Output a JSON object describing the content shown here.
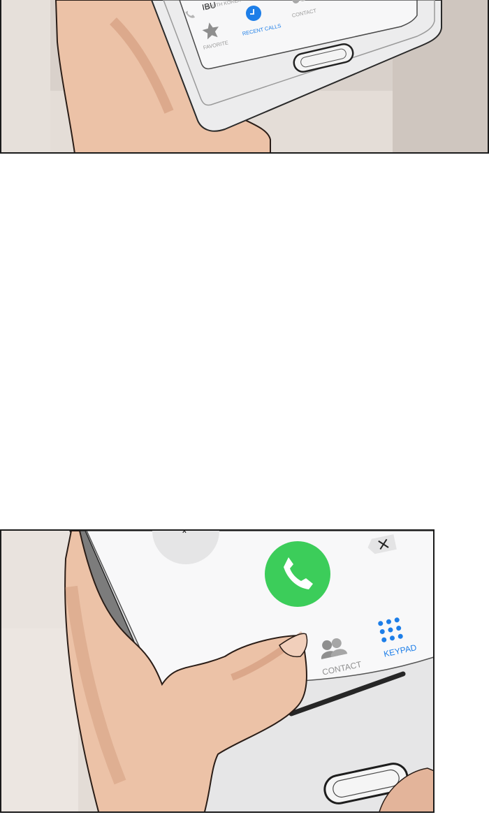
{
  "top_panel": {
    "phone": {
      "contact_name": "IBU",
      "contact_location": "SOUTH KOREA",
      "tabs": [
        {
          "label": "FAVORITE",
          "icon": "star-icon",
          "active": false
        },
        {
          "label": "RECENT CALLS",
          "icon": "clock-icon",
          "active": true
        },
        {
          "label": "CONTACT",
          "icon": "contacts-icon",
          "active": false
        }
      ]
    }
  },
  "bottom_panel": {
    "phone": {
      "call_button_icon": "phone-handset-icon",
      "delete_button_icon": "backspace-x-icon",
      "tabs": [
        {
          "label": "CONTACT",
          "icon": "contacts-icon",
          "active": false
        },
        {
          "label": "KEYPAD",
          "icon": "keypad-icon",
          "active": true
        }
      ]
    }
  },
  "colors": {
    "accent_blue": "#1d7ee8",
    "call_green": "#3ccd5a",
    "inactive_gray": "#9a9a9a",
    "skin": "#e9b89c",
    "skin_shadow": "#c98b6d",
    "phone_body": "#e9e9ea"
  }
}
